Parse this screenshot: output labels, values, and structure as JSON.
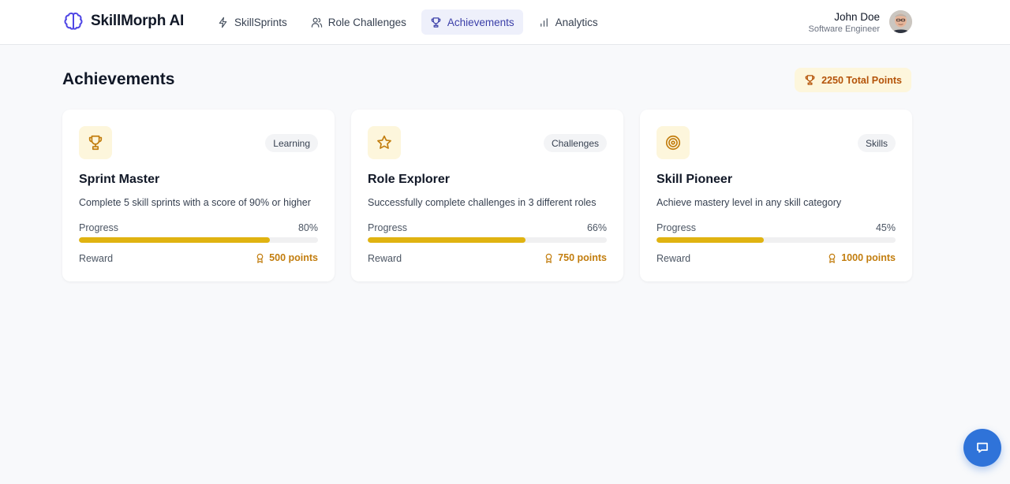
{
  "brand": {
    "name": "SkillMorph AI",
    "icon": "brain-icon"
  },
  "nav": [
    {
      "label": "SkillSprints",
      "icon": "lightning-icon",
      "active": false
    },
    {
      "label": "Role Challenges",
      "icon": "users-icon",
      "active": false
    },
    {
      "label": "Achievements",
      "icon": "trophy-icon",
      "active": true
    },
    {
      "label": "Analytics",
      "icon": "bar-chart-icon",
      "active": false
    }
  ],
  "user": {
    "name": "John Doe",
    "role": "Software Engineer"
  },
  "page": {
    "title": "Achievements",
    "total_points": "2250 Total Points"
  },
  "cards": [
    {
      "icon": "trophy-icon",
      "tag": "Learning",
      "title": "Sprint Master",
      "description": "Complete 5 skill sprints with a score of 90% or higher",
      "progress_label": "Progress",
      "progress_text": "80%",
      "progress": 80,
      "reward_label": "Reward",
      "reward": "500 points"
    },
    {
      "icon": "star-icon",
      "tag": "Challenges",
      "title": "Role Explorer",
      "description": "Successfully complete challenges in 3 different roles",
      "progress_label": "Progress",
      "progress_text": "66%",
      "progress": 66,
      "reward_label": "Reward",
      "reward": "750 points"
    },
    {
      "icon": "target-icon",
      "tag": "Skills",
      "title": "Skill Pioneer",
      "description": "Achieve mastery level in any skill category",
      "progress_label": "Progress",
      "progress_text": "45%",
      "progress": 45,
      "reward_label": "Reward",
      "reward": "1000 points"
    }
  ],
  "colors": {
    "accent": "#3b3fa8",
    "gold": "#e0b311",
    "reward": "#c27d0e",
    "chat_button": "#2f73d9"
  },
  "chat": {
    "icon": "chat-icon"
  }
}
